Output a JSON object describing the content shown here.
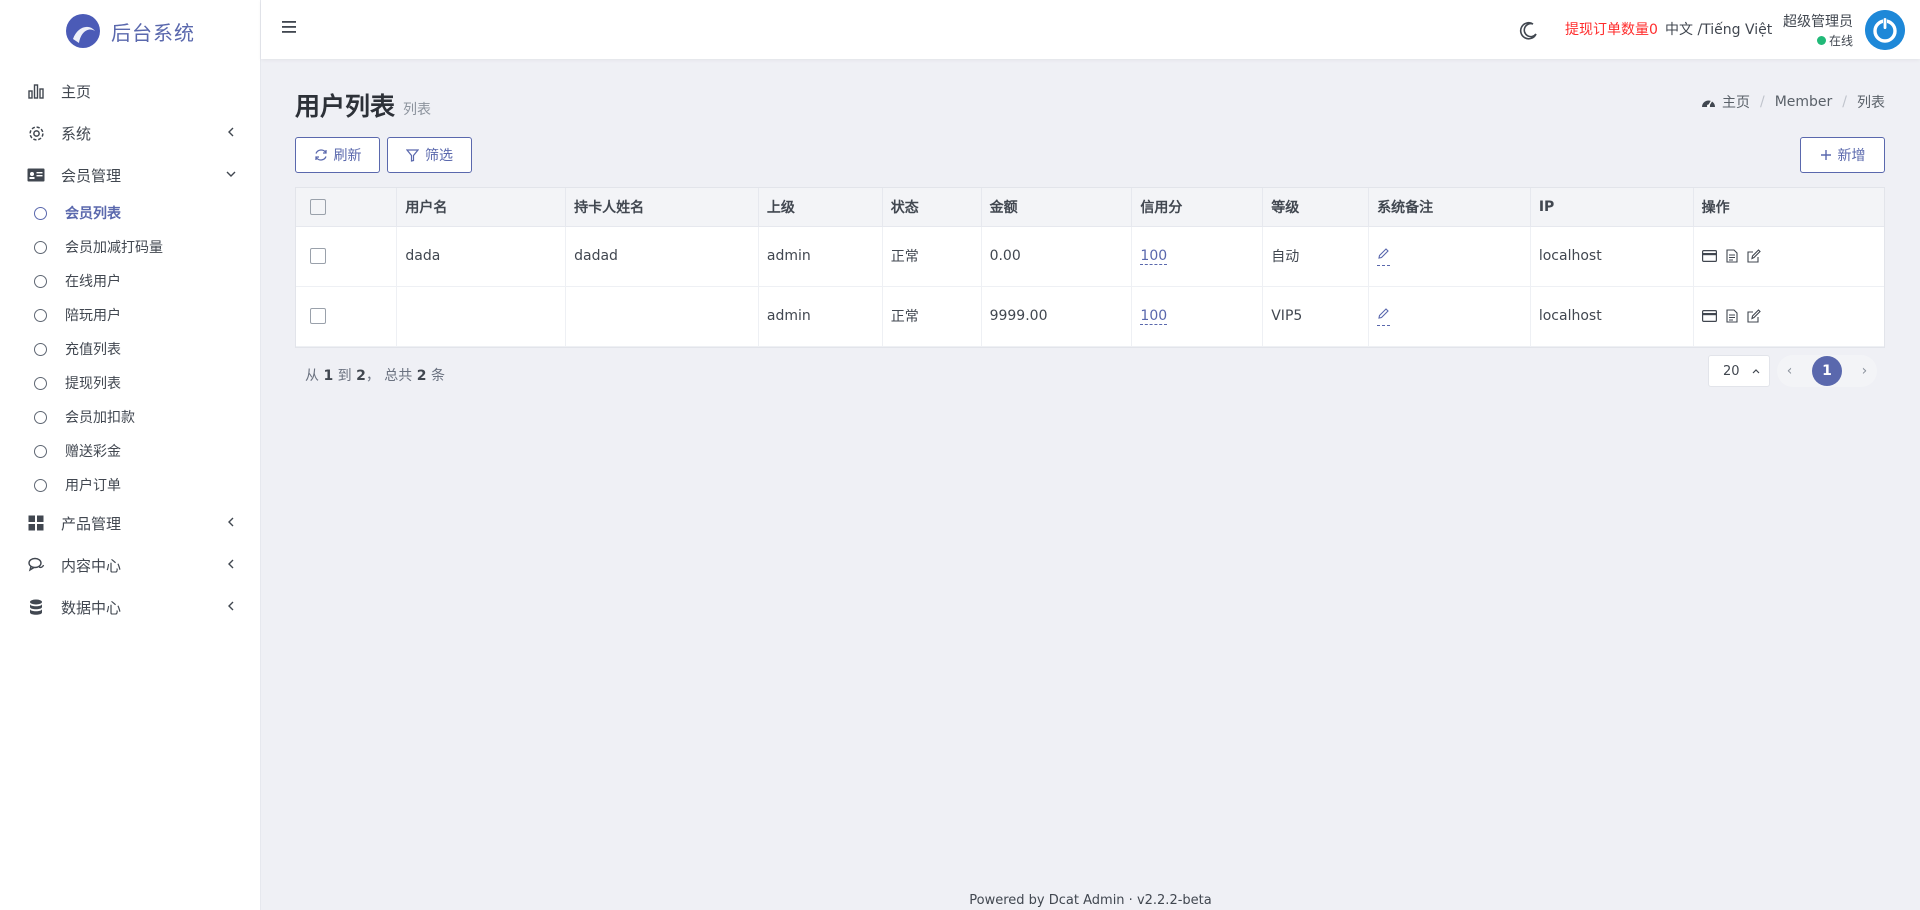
{
  "brand": {
    "name": "后台系统"
  },
  "sidebar": {
    "items": [
      {
        "label": "主页",
        "icon": "bar-chart-icon"
      },
      {
        "label": "系统",
        "icon": "gear-icon"
      },
      {
        "label": "会员管理",
        "icon": "id-card-icon"
      },
      {
        "label": "产品管理",
        "icon": "grid-icon"
      },
      {
        "label": "内容中心",
        "icon": "chat-icon"
      },
      {
        "label": "数据中心",
        "icon": "database-icon"
      }
    ],
    "sub_items": [
      {
        "label": "会员列表"
      },
      {
        "label": "会员加减打码量"
      },
      {
        "label": "在线用户"
      },
      {
        "label": "陪玩用户"
      },
      {
        "label": "充值列表"
      },
      {
        "label": "提现列表"
      },
      {
        "label": "会员加扣款"
      },
      {
        "label": "赠送彩金"
      },
      {
        "label": "用户订单"
      }
    ]
  },
  "topbar": {
    "withdraw_label": "提现订单数量0",
    "lang": "中文 /Tiếng Việt",
    "user_name": "超级管理员",
    "user_status": "在线"
  },
  "page": {
    "title": "用户列表",
    "subtitle": "列表",
    "breadcrumb": [
      "主页",
      "Member",
      "列表"
    ]
  },
  "toolbar": {
    "refresh_label": "刷新",
    "filter_label": "筛选",
    "add_label": "新增"
  },
  "table": {
    "columns": [
      "用户名",
      "持卡人姓名",
      "上级",
      "状态",
      "金额",
      "信用分",
      "等级",
      "系统备注",
      "IP",
      "操作"
    ],
    "rows": [
      {
        "username": "dada",
        "cardholder": "dadad",
        "parent": "admin",
        "status": "正常",
        "amount": "0.00",
        "credit": "100",
        "level": "自动",
        "ip": "localhost"
      },
      {
        "username": "",
        "cardholder": "",
        "parent": "admin",
        "status": "正常",
        "amount": "9999.00",
        "credit": "100",
        "level": "VIP5",
        "ip": "localhost"
      }
    ]
  },
  "pagination": {
    "summary_from_label": "从",
    "from": "1",
    "summary_to_label": "到",
    "to": "2",
    "summary_total_label": "， 总共",
    "total": "2",
    "summary_unit": "条",
    "per_page": "20",
    "current_page": "1"
  },
  "footer": {
    "text": "Powered by Dcat Admin · v2.2.2-beta"
  }
}
